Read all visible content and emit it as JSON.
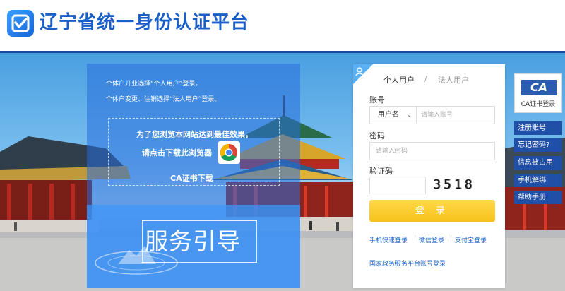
{
  "header": {
    "title": "辽宁省统一身份认证平台"
  },
  "info_panel": {
    "line1": "个体户开业选择“个人用户”登录。",
    "line2": "个体户变更、注销选择“法人用户”登录。",
    "browser_tip_line1": "为了您浏览本网站达到最佳效果，",
    "browser_tip_line2": "请点击下载此浏览器",
    "ca_download": "CA证书下载",
    "guide_title": "服务引导"
  },
  "login": {
    "tabs": [
      {
        "label": "个人用户",
        "active": true
      },
      {
        "label": "/"
      },
      {
        "label": "法人用户",
        "active": false
      }
    ],
    "account_label": "账号",
    "account_type": "用户名",
    "account_placeholder": "请输入账号",
    "password_label": "密码",
    "password_placeholder": "请输入密码",
    "captcha_label": "验证码",
    "captcha_value": "3518",
    "login_button": "登 录",
    "quick_links": [
      "手机快速登录",
      "微信登录",
      "支付宝登录"
    ],
    "gov_link": "国家政务服务平台账号登录"
  },
  "side_tools": {
    "ca_logo": "CA",
    "ca_login": "CA证书登录",
    "buttons": [
      "注册账号",
      "忘记密码?",
      "信息被占用",
      "手机解绑",
      "帮助手册"
    ]
  },
  "colors": {
    "brand_blue": "#1a5fc9",
    "login_yellow": "#f7c21a",
    "side_button": "#1f4fa6"
  }
}
